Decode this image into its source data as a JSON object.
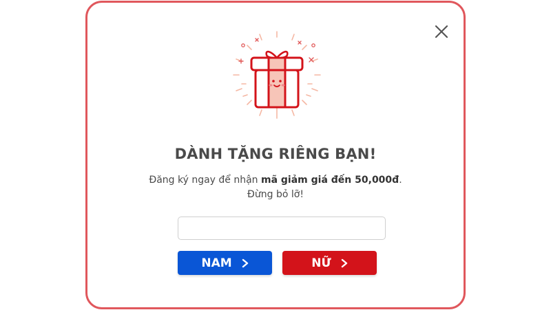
{
  "modal": {
    "border_color": "#e0575c",
    "close_icon": "close-icon",
    "gift_icon": "gift-icon",
    "title": "DÀNH TẶNG RIÊNG BẠN!",
    "description": {
      "prefix": "Đăng ký ngay để nhận ",
      "highlight": "mã giảm giá đến 50,000đ",
      "suffix": ".",
      "line2": "Đừng bỏ lỡ!"
    },
    "input": {
      "value": "",
      "placeholder": ""
    },
    "buttons": {
      "male": {
        "label": "NAM",
        "color": "#0a56d6",
        "icon": "chevron-right-icon"
      },
      "female": {
        "label": "NỮ",
        "color": "#d3131a",
        "icon": "chevron-right-icon"
      }
    }
  }
}
